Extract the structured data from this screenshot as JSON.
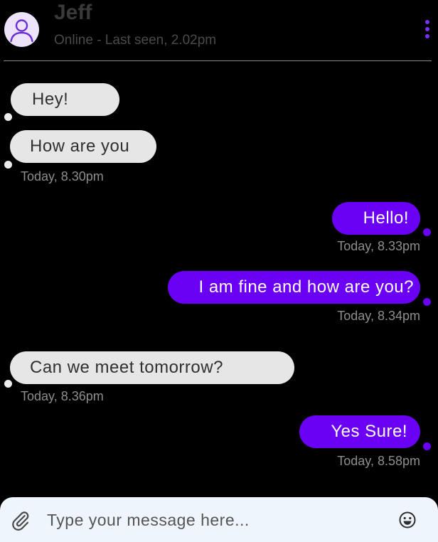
{
  "contact": {
    "name": "Jeff",
    "status": "Online - Last seen, 2.02pm"
  },
  "messages": [
    {
      "direction": "incoming",
      "text": "Hey!"
    },
    {
      "direction": "incoming",
      "text": "How are you",
      "time": "Today, 8.30pm"
    },
    {
      "direction": "outgoing",
      "text": "Hello!",
      "time": "Today, 8.33pm"
    },
    {
      "direction": "outgoing",
      "text": "I am fine and how are you?",
      "time": "Today, 8.34pm"
    },
    {
      "direction": "incoming",
      "text": "Can we meet tomorrow?",
      "time": "Today, 8.36pm"
    },
    {
      "direction": "outgoing",
      "text": "Yes Sure!",
      "time": "Today, 8.58pm"
    }
  ],
  "composer": {
    "placeholder": "Type your message here..."
  },
  "icons": {
    "avatar": "user-avatar-icon",
    "more": "more-vertical-icon",
    "attach": "paperclip-icon",
    "emoji": "smiley-emoji-icon"
  },
  "colors": {
    "accent": "#6a00f4",
    "incoming_bubble": "#e6e6e6",
    "background": "#000000",
    "composer": "#eef5fd"
  }
}
